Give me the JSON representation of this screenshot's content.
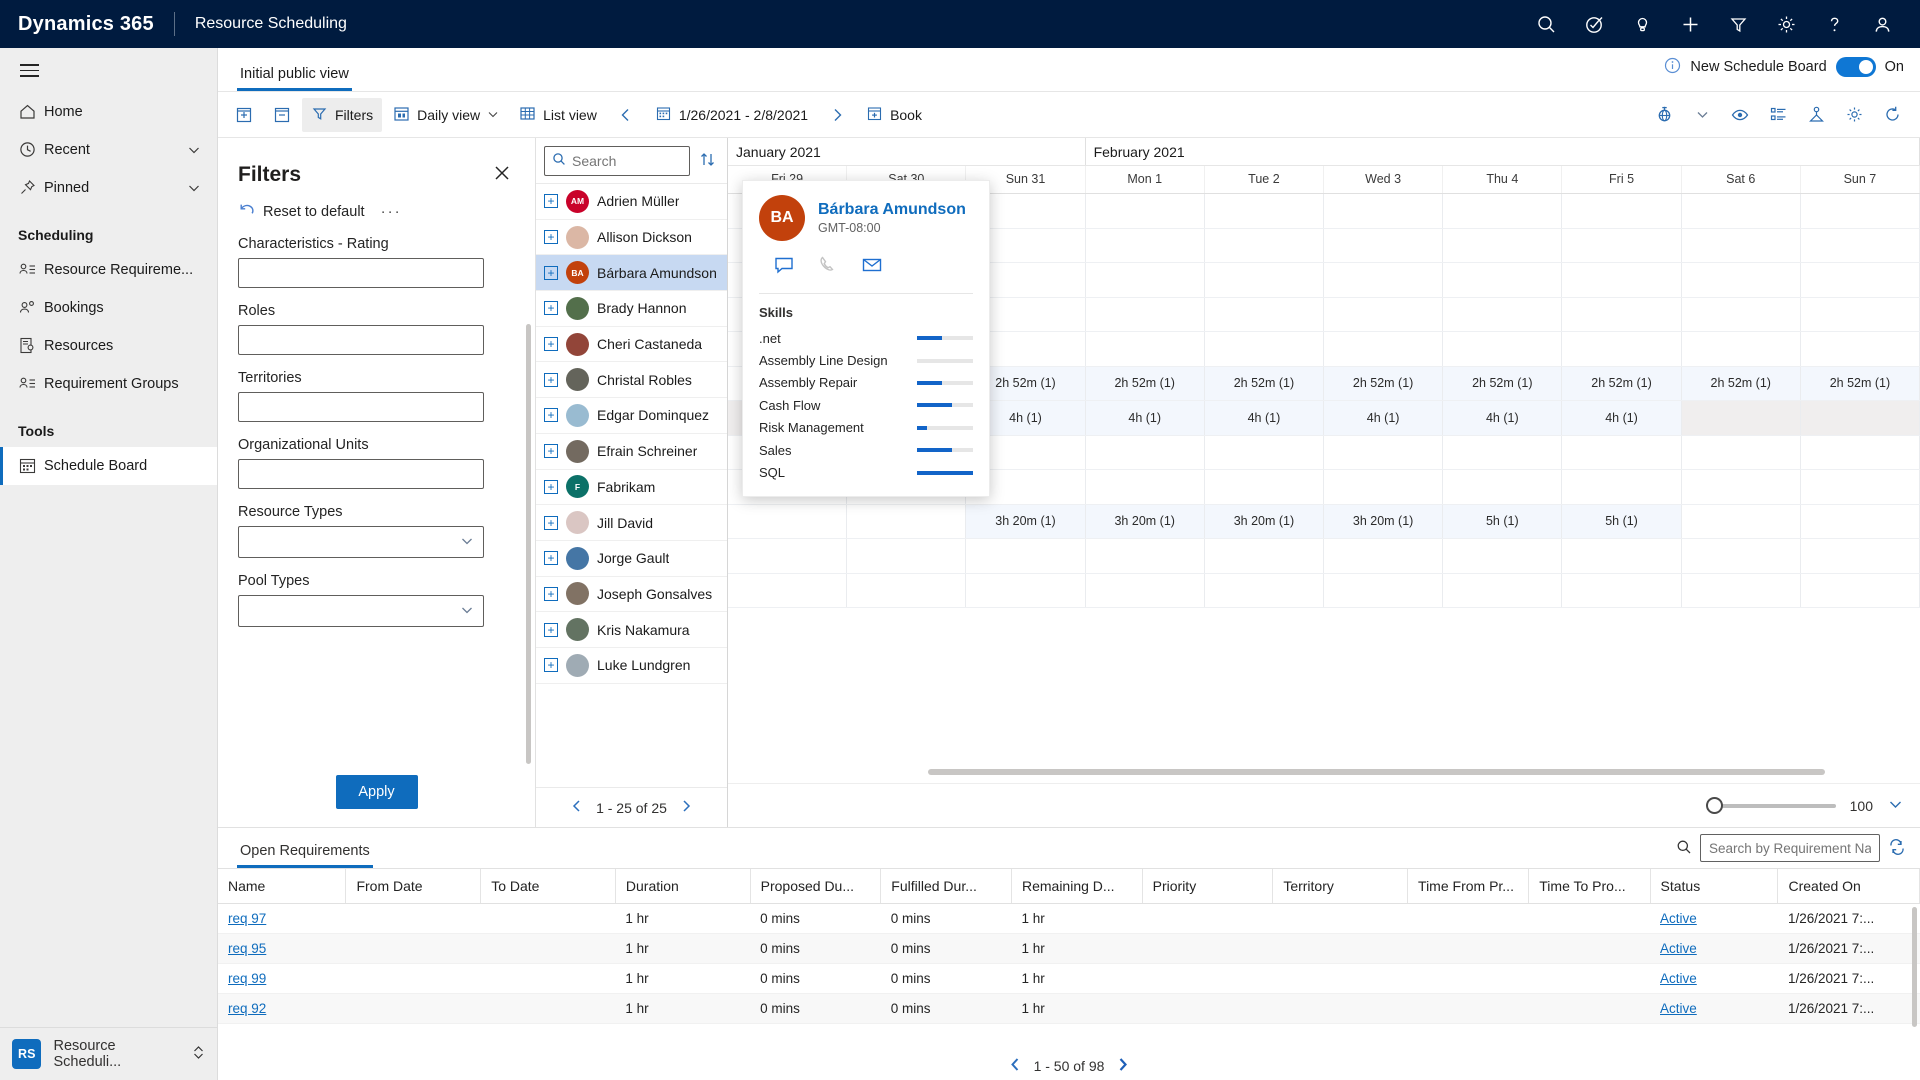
{
  "topnav": {
    "brand": "Dynamics 365",
    "app_name": "Resource Scheduling",
    "icons": [
      {
        "name": "search-icon",
        "label": "Search"
      },
      {
        "name": "assistant-icon",
        "label": "Assistant"
      },
      {
        "name": "lightbulb-icon",
        "label": "Insights"
      },
      {
        "name": "plus-icon",
        "label": "New"
      },
      {
        "name": "filter-icon",
        "label": "Filter"
      },
      {
        "name": "gear-icon",
        "label": "Settings"
      },
      {
        "name": "question-icon",
        "label": "Help"
      },
      {
        "name": "person-icon",
        "label": "Account"
      }
    ]
  },
  "new_schedule_board": {
    "info_icon": "info-icon",
    "label": "New Schedule Board",
    "state": "On",
    "accent": "#0f77d4"
  },
  "sidebar": {
    "hamburger": "hamburger-icon",
    "items": [
      {
        "label": "Home",
        "icon": "home-icon",
        "chevron": false
      },
      {
        "label": "Recent",
        "icon": "clock-icon",
        "chevron": true
      },
      {
        "label": "Pinned",
        "icon": "pin-icon",
        "chevron": true
      }
    ],
    "group_scheduling": "Scheduling",
    "scheduling_items": [
      {
        "label": "Resource Requireme...",
        "icon": "resource-requirement-icon"
      },
      {
        "label": "Bookings",
        "icon": "bookings-icon"
      },
      {
        "label": "Resources",
        "icon": "resources-icon"
      },
      {
        "label": "Requirement Groups",
        "icon": "requirement-groups-icon"
      }
    ],
    "group_tools": "Tools",
    "tools_items": [
      {
        "label": "Schedule Board",
        "icon": "calendar-icon",
        "active": true
      }
    ],
    "app_switcher": {
      "badge": "RS",
      "label": "Resource Scheduli...",
      "chevron": "updown-chevron-icon"
    }
  },
  "view_tabs": [
    {
      "label": "Initial public view",
      "selected": true
    }
  ],
  "toolbar": {
    "expand_all_label": "",
    "collapse_all_label": "",
    "filters_label": "Filters",
    "daily_view_label": "Daily view",
    "list_view_label": "List view",
    "date_range": "1/26/2021 - 2/8/2021",
    "book_label": "Book",
    "right_icons": [
      {
        "name": "map-icon"
      },
      {
        "name": "chevron-down-icon"
      },
      {
        "name": "eye-icon"
      },
      {
        "name": "list-icon"
      },
      {
        "name": "resource-icon"
      },
      {
        "name": "gear-icon"
      },
      {
        "name": "refresh-icon"
      }
    ]
  },
  "filters": {
    "title": "Filters",
    "close_icon": "close-icon",
    "reset_label": "Reset to default",
    "reset_icon": "undo-icon",
    "more_label": "···",
    "fields": [
      {
        "label": "Characteristics - Rating",
        "type": "text",
        "value": "",
        "placeholder": ""
      },
      {
        "label": "Roles",
        "type": "text",
        "value": "",
        "placeholder": ""
      },
      {
        "label": "Territories",
        "type": "text",
        "value": "",
        "placeholder": ""
      },
      {
        "label": "Organizational Units",
        "type": "text",
        "value": "",
        "placeholder": ""
      },
      {
        "label": "Resource Types",
        "type": "select",
        "value": "",
        "placeholder": ""
      },
      {
        "label": "Pool Types",
        "type": "select",
        "value": "",
        "placeholder": ""
      }
    ],
    "apply_label": "Apply"
  },
  "resources": {
    "search_placeholder": "Search",
    "search_value": "",
    "sort_icon": "sort-icon",
    "items": [
      {
        "name": "Adrien Müller",
        "initials": "AM",
        "color": "#c9022a",
        "photo": false
      },
      {
        "name": "Allison Dickson",
        "initials": "AD",
        "color": "#d9b3a0",
        "photo": true
      },
      {
        "name": "Bárbara Amundson",
        "initials": "BA",
        "color": "#c2410c",
        "photo": false,
        "selected": true
      },
      {
        "name": "Brady Hannon",
        "initials": "BH",
        "color": "#4a6741",
        "photo": true
      },
      {
        "name": "Cheri Castaneda",
        "initials": "CC",
        "color": "#8c3b2e",
        "photo": true
      },
      {
        "name": "Christal Robles",
        "initials": "CR",
        "color": "#5c5c52",
        "photo": true
      },
      {
        "name": "Edgar Dominquez",
        "initials": "ED",
        "color": "#93b7cf",
        "photo": true
      },
      {
        "name": "Efrain Schreiner",
        "initials": "ES",
        "color": "#6b6257",
        "photo": true
      },
      {
        "name": "Fabrikam",
        "initials": "F",
        "color": "#0c7168",
        "photo": false
      },
      {
        "name": "Jill David",
        "initials": "JD",
        "color": "#d8c3c0",
        "photo": true
      },
      {
        "name": "Jorge Gault",
        "initials": "JG",
        "color": "#3b6fa0",
        "photo": true
      },
      {
        "name": "Joseph Gonsalves",
        "initials": "JG",
        "color": "#7a6a5c",
        "photo": true
      },
      {
        "name": "Kris Nakamura",
        "initials": "KN",
        "color": "#5b6b5a",
        "photo": true
      },
      {
        "name": "Luke Lundgren",
        "initials": "LL",
        "color": "#9aa7b0",
        "photo": true
      }
    ],
    "pager": "1 - 25 of 25",
    "prev_icon": "chevron-left-icon",
    "next_icon": "chevron-right-icon"
  },
  "grid": {
    "months": [
      {
        "label": "January 2021",
        "days": 3
      },
      {
        "label": "February 2021",
        "days": 7
      }
    ],
    "days": [
      "Fri 29",
      "Sat 30",
      "Sun 31",
      "Mon 1",
      "Tue 2",
      "Wed 3",
      "Thu 4",
      "Fri 5",
      "Sat 6",
      "Sun 7"
    ],
    "rows": [
      {
        "cells": [
          "",
          "",
          "",
          "",
          "",
          "",
          "",
          "",
          "",
          ""
        ],
        "style": "plain"
      },
      {
        "cells": [
          "",
          "",
          "",
          "",
          "",
          "",
          "",
          "",
          "",
          ""
        ],
        "style": "plain"
      },
      {
        "cells": [
          "",
          "",
          "3h 20m (1)",
          "3h 20m (1)",
          "3h 20m (1)",
          "3h 20m (1)",
          "5h (1)",
          "5h (1)",
          "",
          ""
        ],
        "style": "tinted"
      },
      {
        "cells": [
          "",
          "",
          "",
          "",
          "",
          "",
          "",
          "",
          "",
          ""
        ],
        "style": "plain"
      },
      {
        "cells": [
          "",
          "",
          "",
          "",
          "",
          "",
          "",
          "",
          "",
          ""
        ],
        "style": "plain"
      },
      {
        "cells": [
          "",
          "",
          "4h (1)",
          "4h (1)",
          "4h (1)",
          "4h (1)",
          "4h (1)",
          "4h (1)",
          "",
          ""
        ],
        "style": "tinted-grey"
      },
      {
        "cells": [
          "",
          "",
          "2h 52m (1)",
          "2h 52m (1)",
          "2h 52m (1)",
          "2h 52m (1)",
          "2h 52m (1)",
          "2h 52m (1)",
          "2h 52m (1)",
          "2h 52m (1)"
        ],
        "style": "tinted"
      },
      {
        "cells": [
          "",
          "",
          "",
          "",
          "",
          "",
          "",
          "",
          "",
          ""
        ],
        "style": "plain"
      },
      {
        "cells": [
          "",
          "",
          "",
          "",
          "",
          "",
          "",
          "",
          "",
          ""
        ],
        "style": "plain"
      },
      {
        "cells": [
          "",
          "",
          "",
          "",
          "",
          "",
          "",
          "",
          "",
          ""
        ],
        "style": "plain"
      },
      {
        "cells": [
          "",
          "",
          "",
          "",
          "",
          "",
          "",
          "",
          "",
          ""
        ],
        "style": "plain"
      },
      {
        "cells": [
          "",
          "",
          "",
          "",
          "",
          "",
          "",
          "",
          "",
          ""
        ],
        "style": "plain"
      }
    ],
    "zoom_value": "100",
    "collapse_icon": "chevron-down-icon"
  },
  "hovercard": {
    "initials": "BA",
    "avatar_color": "#c2410c",
    "name": "Bárbara Amundson",
    "timezone": "GMT-08:00",
    "actions": [
      {
        "name": "chat-icon",
        "enabled": true
      },
      {
        "name": "phone-icon",
        "enabled": false
      },
      {
        "name": "email-icon",
        "enabled": true
      }
    ],
    "skills_title": "Skills",
    "skills": [
      {
        "name": ".net",
        "rating": 45
      },
      {
        "name": "Assembly Line Design",
        "rating": 0
      },
      {
        "name": "Assembly Repair",
        "rating": 45
      },
      {
        "name": "Cash Flow",
        "rating": 62
      },
      {
        "name": "Risk Management",
        "rating": 17
      },
      {
        "name": "Sales",
        "rating": 62
      },
      {
        "name": "SQL",
        "rating": 100
      }
    ],
    "bar_color": "#1264c8"
  },
  "requirements": {
    "tab_label": "Open Requirements",
    "search_icon": "search-icon",
    "search_placeholder": "Search by Requirement Name",
    "search_value": "",
    "refresh_icon": "refresh-icon",
    "columns": [
      "Name",
      "From Date",
      "To Date",
      "Duration",
      "Proposed Du...",
      "Fulfilled Dur...",
      "Remaining D...",
      "Priority",
      "Territory",
      "Time From Pr...",
      "Time To Pro...",
      "Status",
      "Created On"
    ],
    "rows": [
      {
        "name": "req 97",
        "from_date": "",
        "to_date": "",
        "duration": "1 hr",
        "proposed": "0 mins",
        "fulfilled": "0 mins",
        "remaining": "1 hr",
        "priority": "",
        "territory": "",
        "time_from": "",
        "time_to": "",
        "status": "Active",
        "created_on": "1/26/2021 7:..."
      },
      {
        "name": "req 95",
        "from_date": "",
        "to_date": "",
        "duration": "1 hr",
        "proposed": "0 mins",
        "fulfilled": "0 mins",
        "remaining": "1 hr",
        "priority": "",
        "territory": "",
        "time_from": "",
        "time_to": "",
        "status": "Active",
        "created_on": "1/26/2021 7:..."
      },
      {
        "name": "req 99",
        "from_date": "",
        "to_date": "",
        "duration": "1 hr",
        "proposed": "0 mins",
        "fulfilled": "0 mins",
        "remaining": "1 hr",
        "priority": "",
        "territory": "",
        "time_from": "",
        "time_to": "",
        "status": "Active",
        "created_on": "1/26/2021 7:..."
      },
      {
        "name": "req 92",
        "from_date": "",
        "to_date": "",
        "duration": "1 hr",
        "proposed": "0 mins",
        "fulfilled": "0 mins",
        "remaining": "1 hr",
        "priority": "",
        "territory": "",
        "time_from": "",
        "time_to": "",
        "status": "Active",
        "created_on": "1/26/2021 7:..."
      }
    ],
    "pager": "1 - 50 of 98",
    "prev_icon": "chevron-left-icon",
    "next_icon": "chevron-right-icon"
  }
}
